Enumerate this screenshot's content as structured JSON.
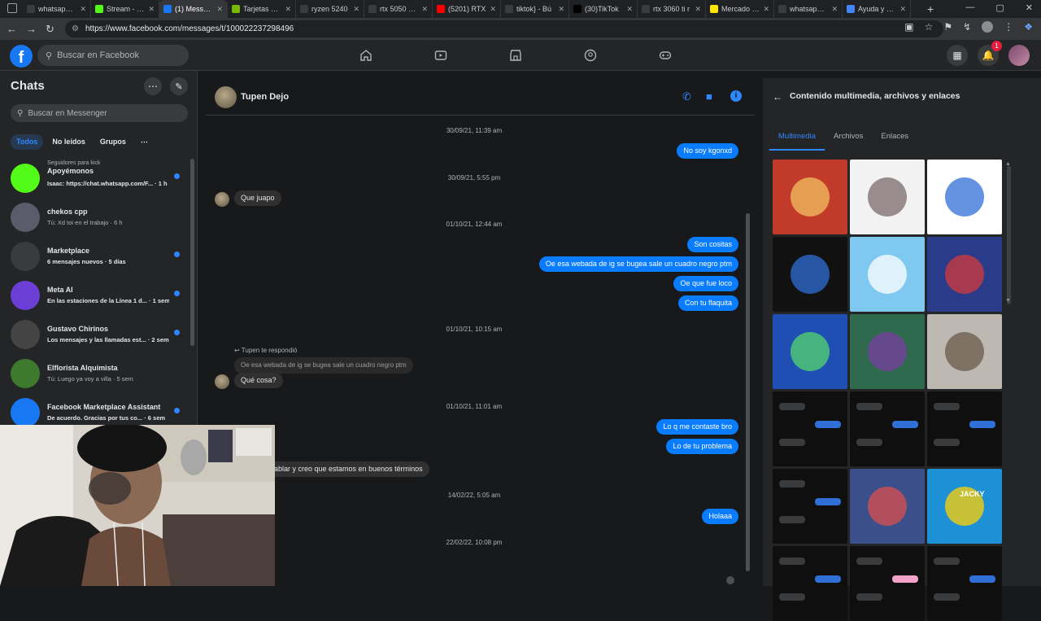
{
  "browser": {
    "tabs": [
      {
        "title": "whatsapp w",
        "icon_color": "#3a3b3c",
        "icon": "search-icon"
      },
      {
        "title": "Stream - Kic",
        "icon_color": "#53fc18",
        "icon": "kick-icon"
      },
      {
        "title": "(1) Messeng",
        "icon_color": "#1877f2",
        "icon": "facebook-icon",
        "active": true
      },
      {
        "title": "Tarjetas Gráf",
        "icon_color": "#76b900",
        "icon": "nvidia-icon"
      },
      {
        "title": "ryzen 5240",
        "icon_color": "#3a3b3c",
        "icon": "search-icon"
      },
      {
        "title": "rtx 5050 8gb",
        "icon_color": "#3a3b3c",
        "icon": "search-icon"
      },
      {
        "title": "(5201) RTX",
        "icon_color": "#ff0000",
        "icon": "youtube-icon"
      },
      {
        "title": "tiktok} - Bú",
        "icon_color": "#3a3b3c",
        "icon": "search-icon"
      },
      {
        "title": "(30)TikTok",
        "icon_color": "#000000",
        "icon": "tiktok-icon"
      },
      {
        "title": "rtx 3060 ti r",
        "icon_color": "#3a3b3c",
        "icon": "search-icon"
      },
      {
        "title": "Mercado Lib",
        "icon_color": "#ffe600",
        "icon": "mercadolibre-icon"
      },
      {
        "title": "whatsapp w",
        "icon_color": "#3a3b3c",
        "icon": "search-icon"
      },
      {
        "title": "Ayuda y apr",
        "icon_color": "#4285f4",
        "icon": "google-icon"
      }
    ],
    "url": "https://www.facebook.com/messages/t/100022237298496"
  },
  "fb": {
    "search_placeholder": "Buscar en Facebook",
    "notif_count": "1"
  },
  "left": {
    "title": "Chats",
    "search_placeholder": "Buscar en Messenger",
    "filters": [
      "Todos",
      "No leídos",
      "Grupos"
    ],
    "chats": [
      {
        "top": "Seguidores para kick",
        "name": "Apoyémonos",
        "preview": "Isaac: https://chat.whatsapp.com/F... · 1 h",
        "unread": true,
        "avatar": "#53fc18"
      },
      {
        "name": "chekos cpp",
        "preview": "Tú: Xd toi en el trabajo · 6 h",
        "unread": false,
        "avatar": "#5b5b6b"
      },
      {
        "name": "Marketplace",
        "preview": "6 mensajes nuevos · 5 días",
        "unread": true,
        "avatar": "#3a3b3c"
      },
      {
        "name": "Meta AI",
        "preview": "En las estaciones de la Línea 1 d... · 1 sem",
        "unread": true,
        "avatar": "#6b3fd6"
      },
      {
        "name": "Gustavo Chirinos",
        "preview": "Los mensajes y las llamadas est... · 2 sem",
        "unread": true,
        "avatar": "#444444"
      },
      {
        "name": "Elflorista Alquimista",
        "preview": "Tú: Luego ya voy a villa · 5 sem",
        "unread": false,
        "avatar": "#3d7a2e"
      },
      {
        "name": "Facebook Marketplace Assistant",
        "preview": "De acuerdo. Gracias por tus co... · 6 sem",
        "unread": true,
        "avatar": "#1877f2"
      }
    ]
  },
  "conversation": {
    "name": "Tupen Dejo",
    "messages": {
      "ts1": "30/09/21, 11:39 am",
      "out1": "No soy kgonxd",
      "ts2": "30/09/21, 5:55 pm",
      "in1": "Que juapo",
      "ts3": "01/10/21, 12:44 am",
      "out2": "Son cositas",
      "out3": "Oe esa webada de ig se bugea sale un cuadro negro ptm",
      "out4": "Oe que fue loco",
      "out5": "Con tu flaquita",
      "ts4": "01/10/21, 10:15 am",
      "replied_label": "Tupen te respondió",
      "quoted": "Oe esa webada de ig se bugea sale un cuadro negro ptm",
      "in2": "Qué cosa?",
      "ts5": "01/10/21, 11:01 am",
      "out6": "Lo q me contaste bro",
      "out7": "Lo de tu problema",
      "in3": "ablar y creo que estamos en buenos términos",
      "ts6": "14/02/22, 5:05 am",
      "out8": "Holaaa",
      "ts7": "22/02/22, 10:08 pm"
    }
  },
  "right": {
    "title": "Contenido multimedia, archivos y enlaces",
    "tabs": [
      "Multimedia",
      "Archivos",
      "Enlaces"
    ],
    "thumbs": [
      {
        "bg": "#c23b2a",
        "accent": "#f0c060"
      },
      {
        "bg": "#f2f2f2",
        "accent": "#7a6a6a"
      },
      {
        "bg": "#ffffff",
        "accent": "#2f6fd6"
      },
      {
        "bg": "#111111",
        "accent": "#2f6fd6"
      },
      {
        "bg": "#7fc8ef",
        "accent": "#ffffff"
      },
      {
        "bg": "#2a3b8a",
        "accent": "#d33b3b"
      },
      {
        "bg": "#1f4fb3",
        "accent": "#56d66f"
      },
      {
        "bg": "#2f6a4f",
        "accent": "#7a3fa0"
      },
      {
        "bg": "#bdb8b2",
        "accent": "#6b5a4a"
      },
      {
        "bg": "#0f0f0f",
        "accent": "#2f6fd6"
      },
      {
        "bg": "#0f0f0f",
        "accent": "#2f6fd6"
      },
      {
        "bg": "#0f0f0f",
        "accent": "#2f6fd6"
      },
      {
        "bg": "#0f0f0f",
        "accent": "#2f6fd6"
      },
      {
        "bg": "#3b4f8a",
        "accent": "#d94f4f"
      },
      {
        "bg": "#1e90d6",
        "accent": "#ffd200"
      },
      {
        "bg": "#0f0f0f",
        "accent": "#2f6fd6"
      },
      {
        "bg": "#0f0f0f",
        "accent": "#f3a3c8"
      },
      {
        "bg": "#0f0f0f",
        "accent": "#2f6fd6"
      }
    ],
    "thumb_labels": [
      "JACKY"
    ]
  }
}
